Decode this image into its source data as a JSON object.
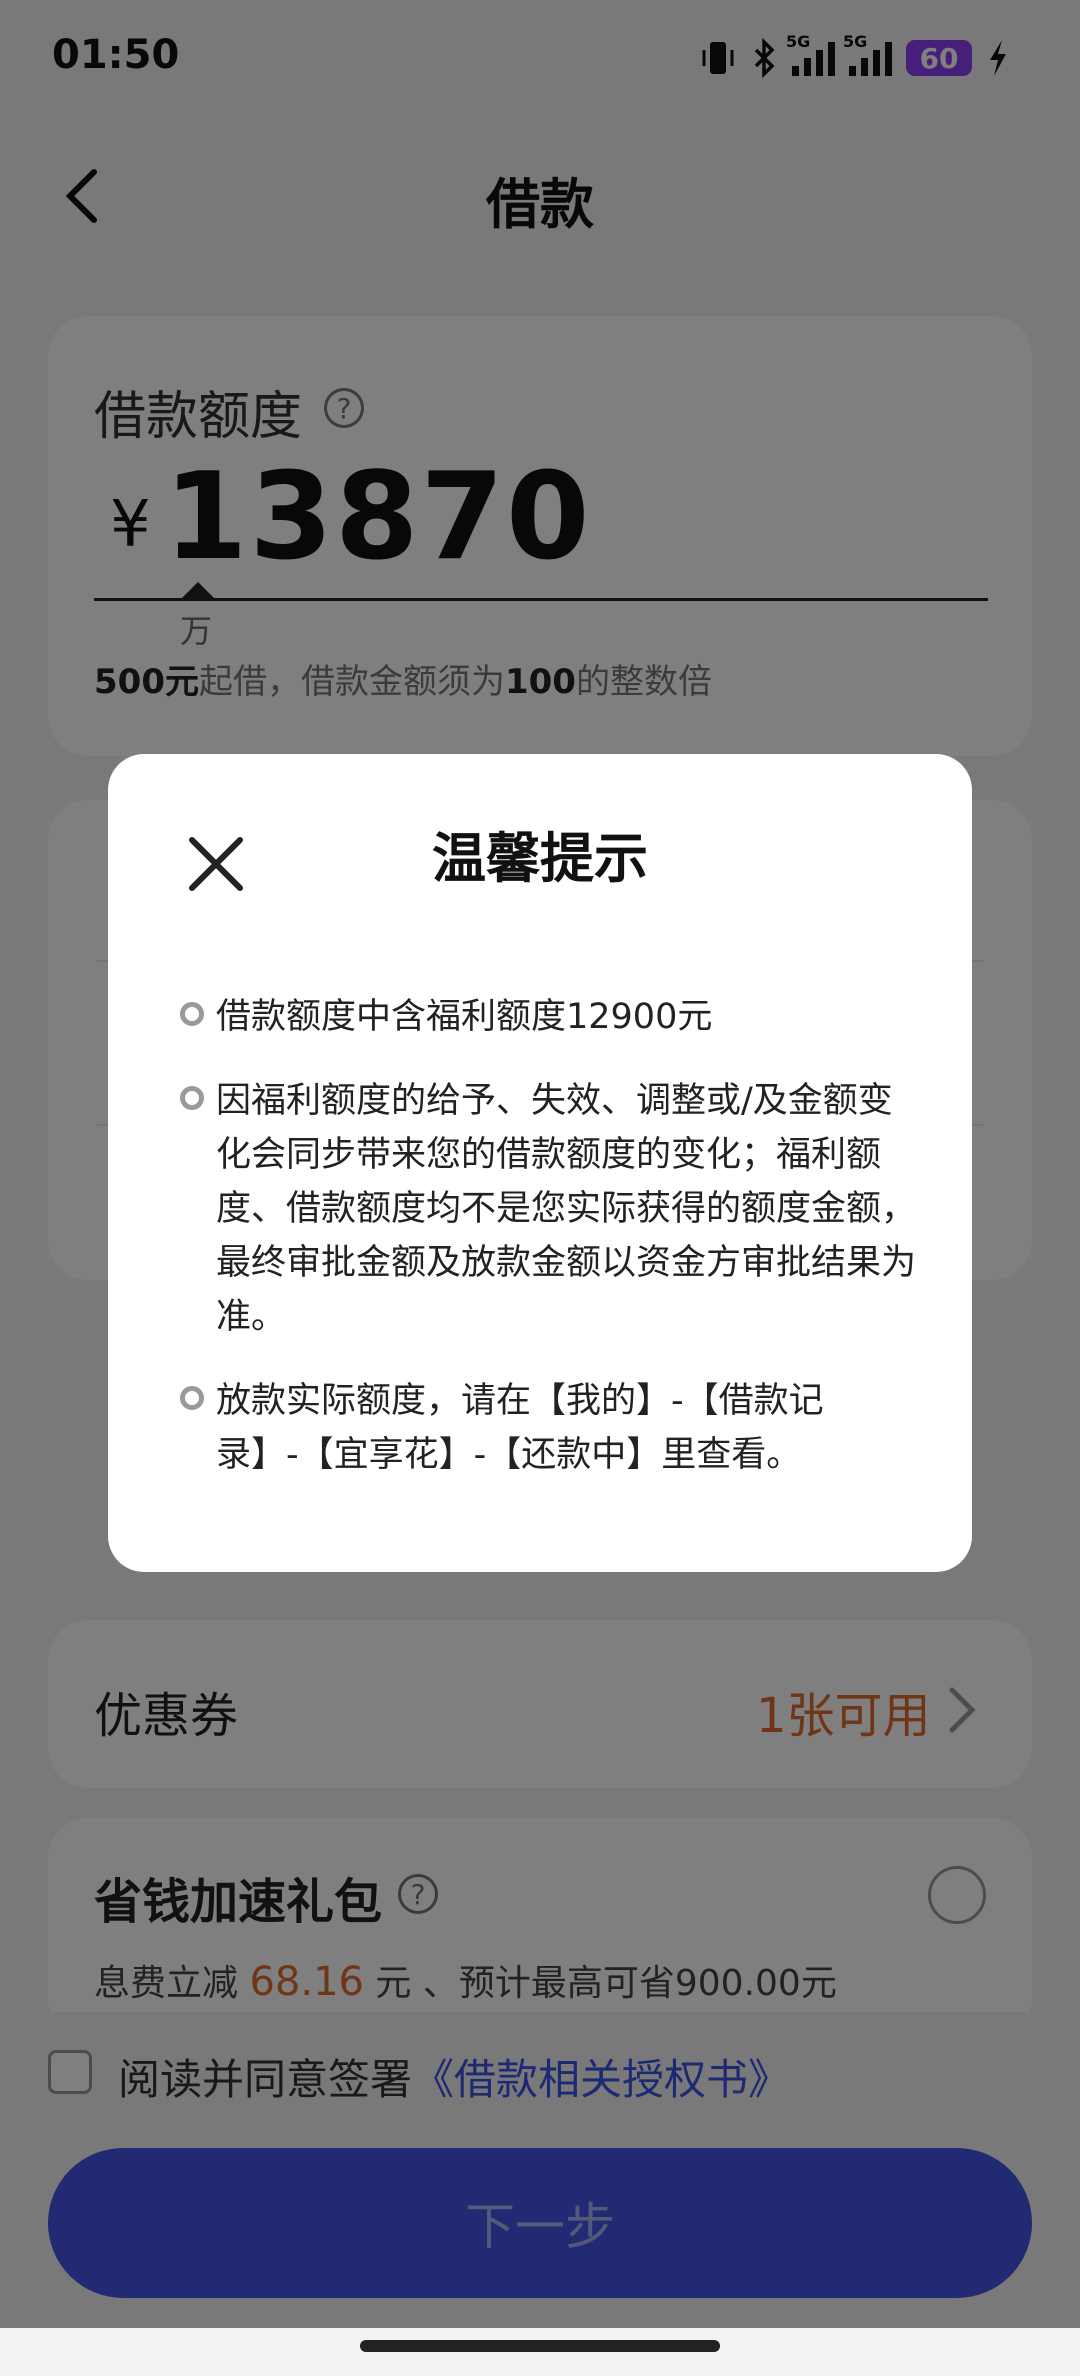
{
  "status_bar": {
    "time": "01:50",
    "signal1_label": "5G",
    "signal2_label": "5G",
    "battery": "60"
  },
  "header": {
    "title": "借款"
  },
  "amount": {
    "label": "借款额度",
    "currency": "¥",
    "value": "13870",
    "unit_hint": "万",
    "hint_min": "500元",
    "hint_mid": "起借，借款金额须为",
    "hint_mult": "100",
    "hint_end": "的整数倍"
  },
  "coupon": {
    "label": "优惠券",
    "value": "1张可用"
  },
  "package": {
    "title": "省钱加速礼包",
    "desc_prefix": "息费立减 ",
    "desc_amount": "68.16",
    "desc_suffix": " 元 、预计最高可省900.00元"
  },
  "agreement": {
    "text": "阅读并同意签署",
    "link": "《借款相关授权书》"
  },
  "next_button": "下一步",
  "modal": {
    "title": "温馨提示",
    "items": [
      "借款额度中含福利额度12900元",
      "因福利额度的给予、失效、调整或/及金额变化会同步带来您的借款额度的变化；福利额度、借款额度均不是您实际获得的额度金额，最终审批金额及放款金额以资金方审批结果为准。",
      "放款实际额度，请在【我的】-【借款记录】-【宜享花】-【还款中】里查看。"
    ]
  },
  "colors": {
    "accent": "#4355e6",
    "highlight": "#e06a2c",
    "battery": "#8a3ff5"
  }
}
